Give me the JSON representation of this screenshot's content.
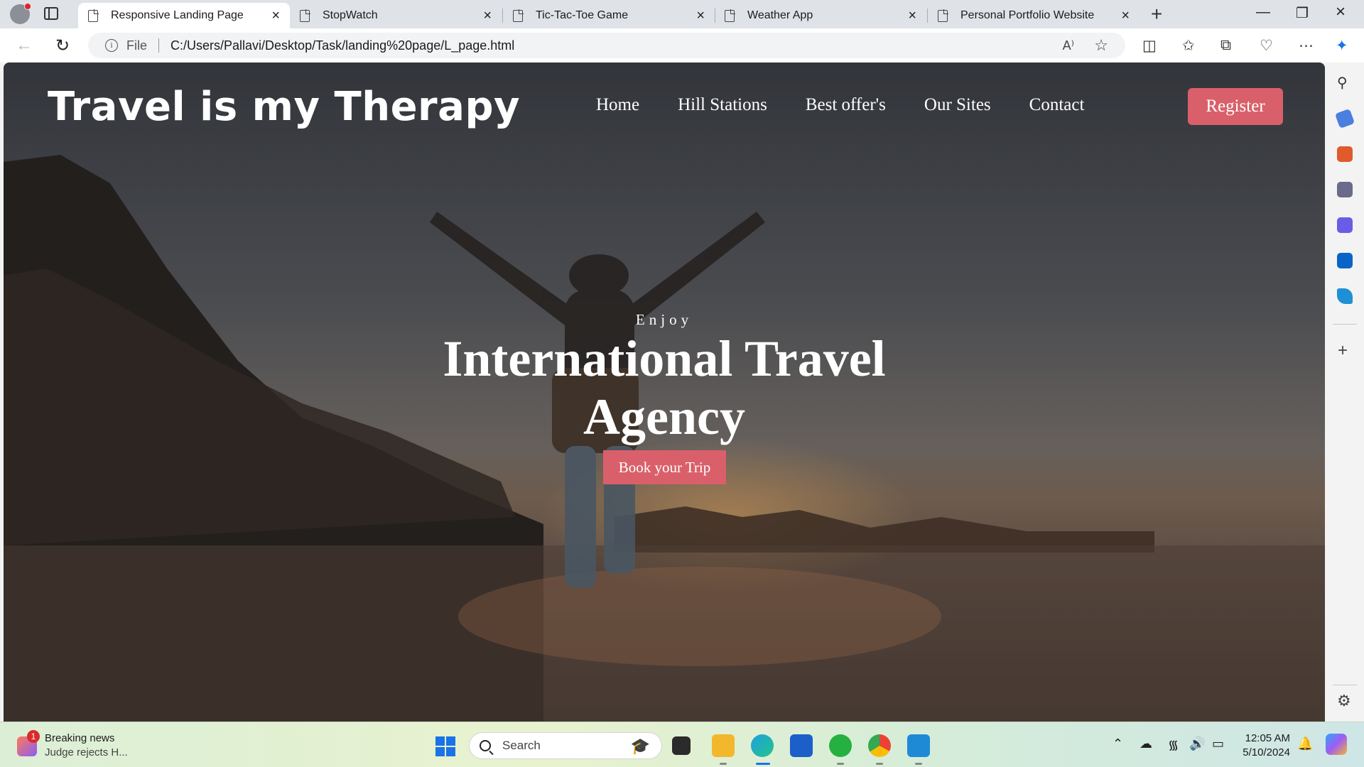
{
  "browser": {
    "tabs": [
      {
        "label": "Responsive Landing Page",
        "active": true
      },
      {
        "label": "StopWatch",
        "active": false
      },
      {
        "label": "Tic-Tac-Toe Game",
        "active": false
      },
      {
        "label": "Weather App",
        "active": false
      },
      {
        "label": "Personal Portfolio Website",
        "active": false
      }
    ],
    "address": {
      "scheme_label": "File",
      "url": "C:/Users/Pallavi/Desktop/Task/landing%20page/L_page.html"
    }
  },
  "page": {
    "brand": "Travel is my Therapy",
    "nav": [
      "Home",
      "Hill Stations",
      "Best offer's",
      "Our Sites",
      "Contact"
    ],
    "register_label": "Register",
    "hero": {
      "eyebrow": "Enjoy",
      "headline_line1": "International Travel",
      "headline_line2": "Agency",
      "cta_label": "Book your Trip"
    },
    "colors": {
      "accent": "#d9606a",
      "text": "#ffffff"
    }
  },
  "taskbar": {
    "news_badge": "1",
    "news_title": "Breaking news",
    "news_sub": "Judge rejects H...",
    "search_placeholder": "Search",
    "time": "12:05 AM",
    "date": "5/10/2024"
  }
}
